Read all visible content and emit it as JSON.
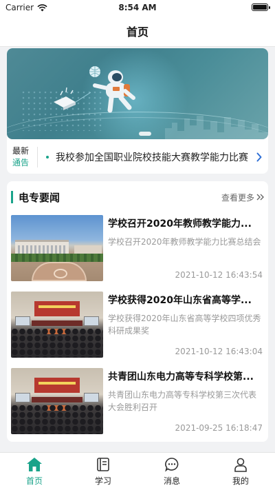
{
  "status_bar": {
    "carrier": "Carrier",
    "time": "8:54 AM"
  },
  "navbar": {
    "title": "首页"
  },
  "notice": {
    "tag_line1": "最新",
    "tag_line2": "通告",
    "text": "我校参加全国职业院校技能大赛教学能力比赛"
  },
  "news": {
    "section_title": "电专要闻",
    "more_label": "查看更多",
    "items": [
      {
        "title": "学校召开2020年教师教学能力...",
        "desc": "学校召开2020年教师教学能力比赛总结会",
        "date": "2021-10-12 16:43:54",
        "image": "campus-aerial-photo"
      },
      {
        "title": "学校获得2020年山东省高等学...",
        "desc": "学校获得2020年山东省高等学校四项优秀科研成果奖",
        "date": "2021-10-12 16:43:04",
        "image": "meeting-hall-photo"
      },
      {
        "title": "共青团山东电力高等专科学校第...",
        "desc": "共青团山东电力高等专科学校第三次代表大会胜利召开",
        "date": "2021-09-25 16:18:47",
        "image": "meeting-hall-photo"
      }
    ]
  },
  "tabbar": {
    "tabs": [
      {
        "label": "首页",
        "icon": "home-icon",
        "active": true
      },
      {
        "label": "学习",
        "icon": "book-icon",
        "active": false
      },
      {
        "label": "消息",
        "icon": "message-icon",
        "active": false
      },
      {
        "label": "我的",
        "icon": "profile-icon",
        "active": false
      }
    ]
  },
  "colors": {
    "accent": "#19a38a",
    "page_background": "#f1f2f4",
    "banner_teal": "#4a8d98"
  }
}
